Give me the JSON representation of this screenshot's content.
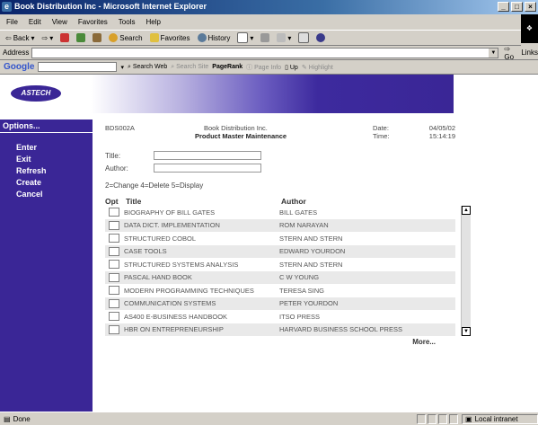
{
  "window": {
    "title": "Book Distribution Inc - Microsoft Internet Explorer",
    "min": "_",
    "max": "□",
    "close": "×"
  },
  "menu": [
    "File",
    "Edit",
    "View",
    "Favorites",
    "Tools",
    "Help"
  ],
  "toolbar": {
    "back": "Back",
    "search": "Search",
    "favorites": "Favorites",
    "history": "History"
  },
  "address": {
    "label": "Address",
    "value": "",
    "go": "Go",
    "links": "Links"
  },
  "google_bar": {
    "logo": "Google",
    "search_web": "Search Web",
    "search_site": "Search Site",
    "pagerank": "PageRank",
    "page_info": "Page Info",
    "up": "Up",
    "highlight": "Highlight"
  },
  "banner": {
    "logo_text": "ASTECH"
  },
  "sidebar": {
    "header": "Options...",
    "items": [
      "Enter",
      "Exit",
      "Refresh",
      "Create",
      "Cancel"
    ]
  },
  "screen": {
    "program_id": "BDS002A",
    "company": "Book Distribution Inc.",
    "screen_title": "Product Master Maintenance",
    "date_label": "Date:",
    "date_value": "04/05/02",
    "time_label": "Time:",
    "time_value": "15:14:19"
  },
  "filters": {
    "title_label": "Title:",
    "title_value": "",
    "author_label": "Author:",
    "author_value": ""
  },
  "legend": "2=Change   4=Delete   5=Display",
  "list": {
    "col_opt": "Opt",
    "col_title": "Title",
    "col_author": "Author",
    "rows": [
      {
        "title": "BIOGRAPHY OF BILL GATES",
        "author": "BILL GATES"
      },
      {
        "title": "DATA DICT. IMPLEMENTATION",
        "author": "ROM NARAYAN"
      },
      {
        "title": "STRUCTURED COBOL",
        "author": "STERN AND STERN"
      },
      {
        "title": "CASE TOOLS",
        "author": "EDWARD YOURDON"
      },
      {
        "title": "STRUCTURED SYSTEMS ANALYSIS",
        "author": "STERN AND STERN"
      },
      {
        "title": "PASCAL HAND BOOK",
        "author": "C W YOUNG"
      },
      {
        "title": "MODERN PROGRAMMING TECHNIQUES",
        "author": "TERESA SING"
      },
      {
        "title": "COMMUNICATION SYSTEMS",
        "author": "PETER YOURDON"
      },
      {
        "title": "AS400 E-BUSINESS HANDBOOK",
        "author": "ITSO PRESS"
      },
      {
        "title": "HBR ON ENTREPRENEURSHIP",
        "author": "HARVARD BUSINESS SCHOOL PRESS"
      }
    ],
    "more": "More..."
  },
  "status": {
    "text": "Done",
    "zone": "Local intranet"
  },
  "colors": {
    "brand_purple": "#3a2696",
    "titlebar": "#0a246a"
  }
}
